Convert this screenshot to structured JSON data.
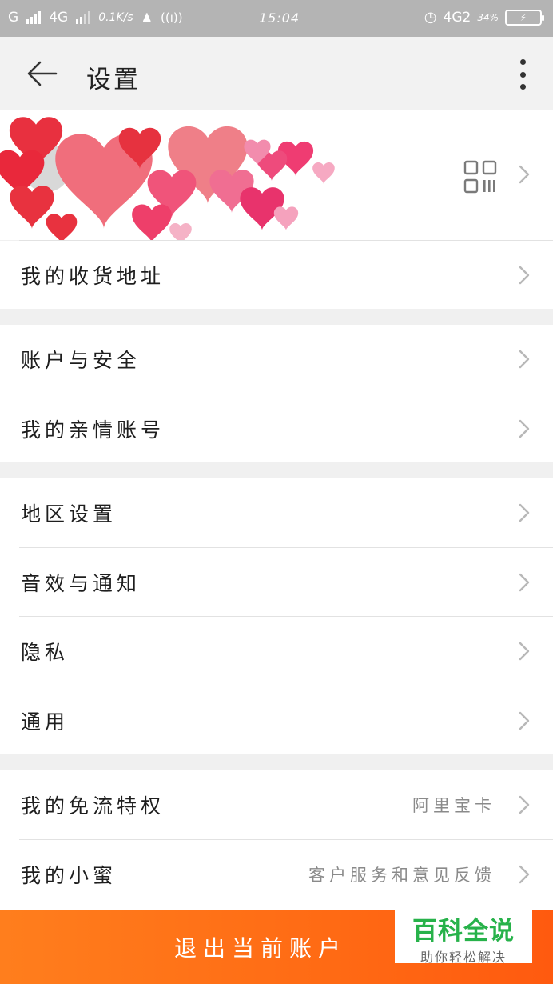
{
  "status_bar": {
    "carrier1": "G",
    "carrier2": "4G",
    "speed": "0.1K/s",
    "time": "15:04",
    "network_right": "4G2",
    "battery_pct": "34%",
    "battery_label": "⚡"
  },
  "header": {
    "title": "设置"
  },
  "profile": {
    "qr_icon": "qrcode-icon"
  },
  "sections": {
    "address": {
      "label": "我的收货地址"
    },
    "account": [
      {
        "label": "账户与安全"
      },
      {
        "label": "我的亲情账号"
      }
    ],
    "general": [
      {
        "label": "地区设置"
      },
      {
        "label": "音效与通知"
      },
      {
        "label": "隐私"
      },
      {
        "label": "通用"
      }
    ],
    "extra": [
      {
        "label": "我的免流特权",
        "value": "阿里宝卡"
      },
      {
        "label": "我的小蜜",
        "value": "客户服务和意见反馈"
      }
    ]
  },
  "footer": {
    "logout_label": "退出当前账户"
  },
  "watermark": {
    "title": "百科全说",
    "subtitle": "助你轻松解决"
  },
  "colors": {
    "accent": "#ff6a14",
    "watermark_green": "#27b24a"
  }
}
